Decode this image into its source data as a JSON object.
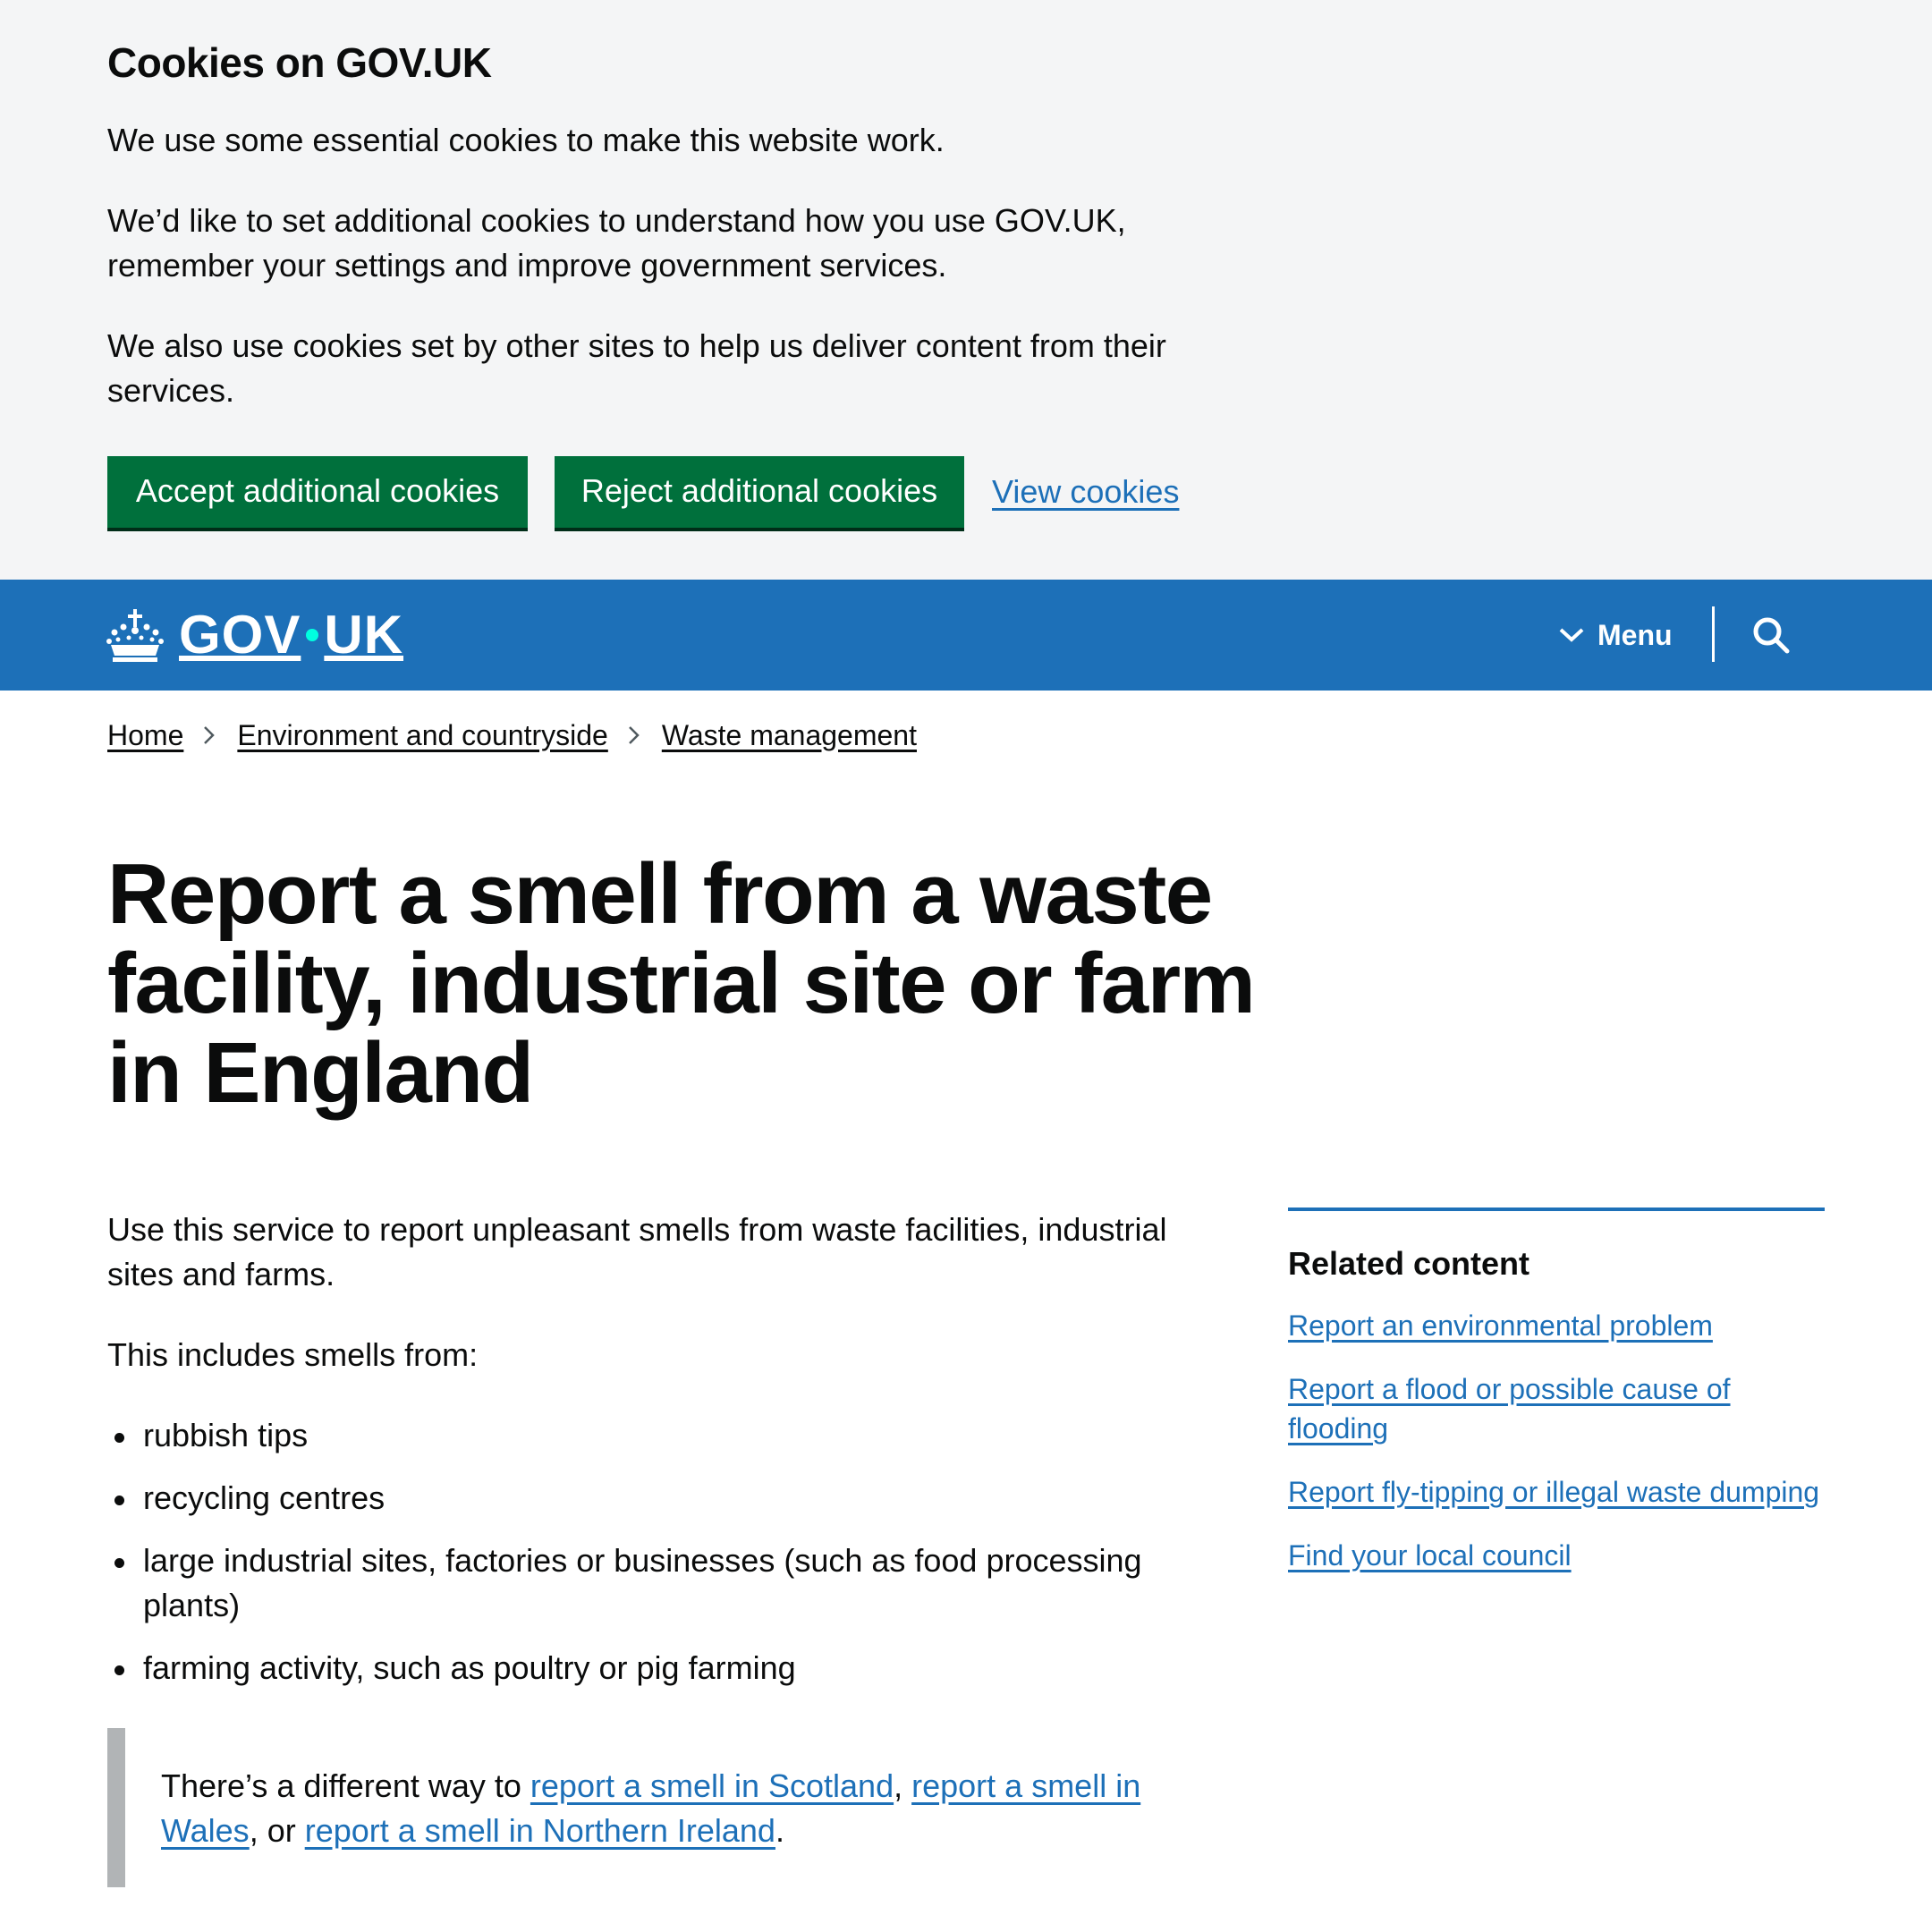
{
  "cookie_banner": {
    "title": "Cookies on GOV.UK",
    "p1": "We use some essential cookies to make this website work.",
    "p2": "We’d like to set additional cookies to understand how you use GOV.UK, remember your settings and improve government services.",
    "p3": "We also use cookies set by other sites to help us deliver content from their services.",
    "accept_label": "Accept additional cookies",
    "reject_label": "Reject additional cookies",
    "view_label": "View cookies"
  },
  "header": {
    "logo_left": "GOV",
    "logo_right": "UK",
    "menu_label": "Menu",
    "logo_dot_color": "#00ffe0",
    "bar_color": "#1d70b8"
  },
  "breadcrumb": [
    "Home",
    "Environment and countryside",
    "Waste management"
  ],
  "page": {
    "title": "Report a smell from a waste facility, industrial site or farm in England",
    "intro": "Use this service to report unpleasant smells from waste facilities, industrial sites and farms.",
    "includes": "This includes smells from:",
    "bullets": [
      "rubbish tips",
      "recycling centres",
      "large industrial sites, factories or businesses (such as food processing plants)",
      "farming activity, such as poultry or pig farming"
    ],
    "inset": {
      "prefix": "There’s a different way to ",
      "link1": "report a smell in Scotland",
      "sep1": ", ",
      "link2": "report a smell in Wales",
      "sep2": ", or ",
      "link3": "report a smell in Northern Ireland",
      "suffix": "."
    }
  },
  "related": {
    "title": "Related content",
    "links": [
      "Report an environmental problem",
      "Report a flood or possible cause of flooding",
      "Report fly-tipping or illegal waste dumping",
      "Find your local council"
    ]
  },
  "colors": {
    "button_green": "#00703c",
    "link_blue": "#1d70b8",
    "text": "#0b0c0c"
  }
}
